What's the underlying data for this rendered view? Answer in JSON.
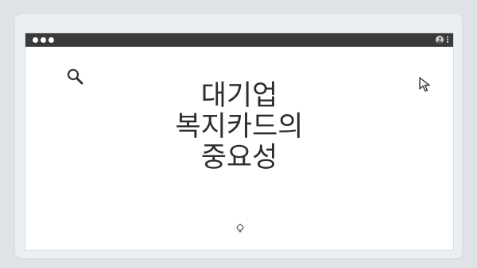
{
  "window": {
    "title_lines": [
      "대기업",
      "복지카드의",
      "중요성"
    ]
  },
  "icons": {
    "top_indicator": "pagination-dots",
    "titlebar_dots": "window-control-dots",
    "account": "user-icon",
    "menu": "kebab-menu-icon",
    "search": "search-icon",
    "pointer": "cursor-icon",
    "bulb": "lightbulb-icon"
  },
  "colors": {
    "background": "#dfe3e8",
    "titlebar": "#3a3a3a",
    "text": "#2d2d2d"
  }
}
